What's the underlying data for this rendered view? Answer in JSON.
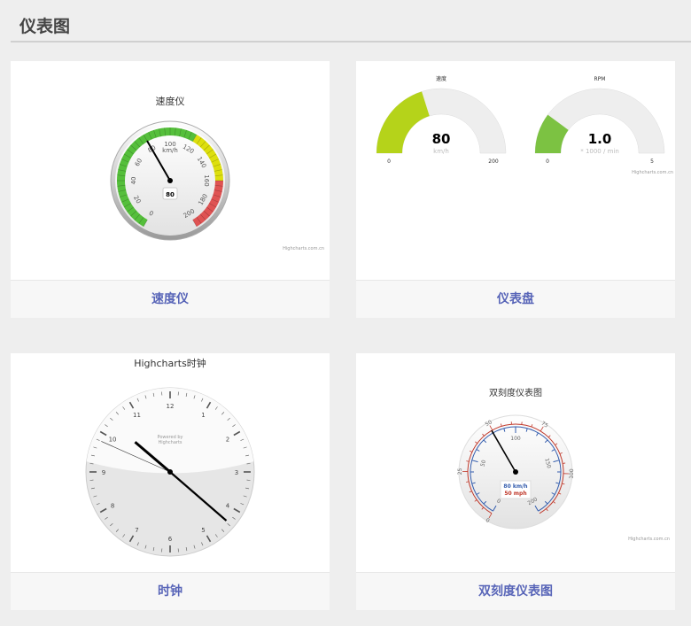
{
  "page_title": "仪表图",
  "cards": [
    {
      "label": "速度仪",
      "chart_title": "速度仪",
      "unit": "km/h",
      "value": 80,
      "min": 0,
      "max": 200,
      "ticks": [
        "0",
        "20",
        "40",
        "60",
        "80",
        "100",
        "120",
        "140",
        "160",
        "180",
        "200"
      ],
      "bands": [
        {
          "from": 0,
          "to": 120,
          "color": "#55bf3b"
        },
        {
          "from": 120,
          "to": 160,
          "color": "#dddf0d"
        },
        {
          "from": 160,
          "to": 200,
          "color": "#df5353"
        }
      ],
      "credit": "Highcharts.com.cn"
    },
    {
      "label": "仪表盘",
      "credit": "Highcharts.com.cn",
      "gauges": [
        {
          "title": "速度",
          "value": "80",
          "value_num": 80,
          "unit": "km/h",
          "min": "0",
          "max": "200",
          "min_num": 0,
          "max_num": 200,
          "color": "#b5d31a"
        },
        {
          "title": "RPM",
          "value": "1.0",
          "value_num": 1.0,
          "unit": "* 1000 / min",
          "min": "0",
          "max": "5",
          "min_num": 0,
          "max_num": 5,
          "color": "#7cc242"
        }
      ]
    },
    {
      "label": "时钟",
      "chart_title": "Highcharts时钟",
      "powered": "Powered by",
      "powered2": "Highcharts",
      "numbers": [
        "12",
        "1",
        "2",
        "3",
        "4",
        "5",
        "6",
        "7",
        "8",
        "9",
        "10",
        "11"
      ],
      "time": {
        "hours": 10,
        "minutes": 21,
        "seconds": 49
      }
    },
    {
      "label": "双刻度仪表图",
      "chart_title": "双刻度仪表图",
      "credit": "Highcharts.com.cn",
      "kmh_ticks": [
        "0",
        "50",
        "100",
        "150",
        "200"
      ],
      "mph_ticks": [
        "0",
        "25",
        "50",
        "75",
        "100"
      ],
      "kmh_max": 200,
      "mph_max": 124,
      "value": 80,
      "readout_kmh": "80 km/h",
      "readout_mph": "50 mph",
      "kmh_color": "#335cad",
      "mph_color": "#c0392b"
    }
  ]
}
